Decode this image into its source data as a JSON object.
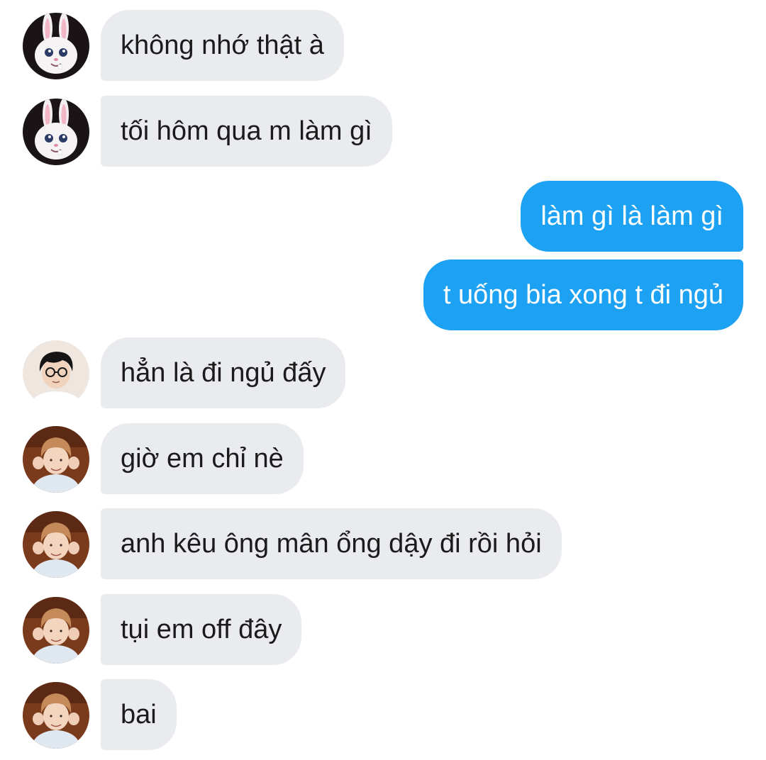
{
  "conversation": {
    "messages": [
      {
        "sender": "bunny",
        "text": "không nhớ thật à"
      },
      {
        "sender": "bunny",
        "text": "tối hôm qua m làm gì"
      },
      {
        "sender": "me",
        "text": "làm gì là làm gì"
      },
      {
        "sender": "me",
        "text": "t uống bia xong t đi ngủ"
      },
      {
        "sender": "glasses-boy",
        "text": "hẳn là đi ngủ đấy"
      },
      {
        "sender": "heart-boy",
        "text": "giờ em chỉ nè"
      },
      {
        "sender": "heart-boy",
        "text": "anh kêu ông mân ổng dậy đi rồi hỏi"
      },
      {
        "sender": "heart-boy",
        "text": "tụi em off đây"
      },
      {
        "sender": "heart-boy",
        "text": "bai"
      }
    ]
  },
  "colors": {
    "incoming_bubble": "#e9ebef",
    "outgoing_bubble": "#1da1f2",
    "background": "#ffffff"
  }
}
